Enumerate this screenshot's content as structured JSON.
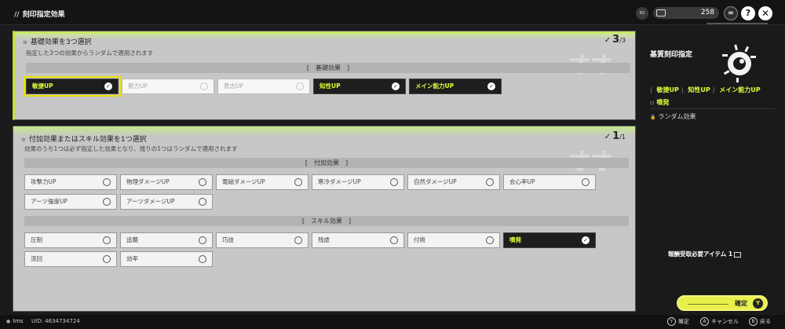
{
  "header": {
    "title": "刻印指定効果",
    "rs_label": "RS",
    "currency_value": "258",
    "link_icon": "link-icon",
    "help_icon": "help-icon",
    "close_icon": "close-icon"
  },
  "basic": {
    "title": "基礎効果を3つ選択",
    "subtitle": "指定した3つの効果からランダムで適用されます",
    "count": "3",
    "total": "/3",
    "section_label": "[　基礎効果　]",
    "options": [
      {
        "label": "敏捷UP",
        "state": "selected"
      },
      {
        "label": "筋力UP",
        "state": "disabled"
      },
      {
        "label": "意志UP",
        "state": "disabled"
      },
      {
        "label": "知性UP",
        "state": "selected"
      },
      {
        "label": "メイン能力UP",
        "state": "selected"
      }
    ]
  },
  "extra": {
    "title": "付加効果またはスキル効果を1つ選択",
    "subtitle": "効果のうち1つは必ず指定した効果となり、残りの1つはランダムで適用されます",
    "count": "1",
    "total": "/1",
    "extra_section_label": "[　付加効果　]",
    "extra_options": [
      {
        "label": "攻撃力UP"
      },
      {
        "label": "物理ダメージUP"
      },
      {
        "label": "電磁ダメージUP"
      },
      {
        "label": "寒冷ダメージUP"
      },
      {
        "label": "自然ダメージUP"
      },
      {
        "label": "会心率UP"
      },
      {
        "label": "アーツ強度UP"
      },
      {
        "label": "アーツダメージUP"
      }
    ],
    "skill_section_label": "[　スキル効果　]",
    "skill_options": [
      {
        "label": "圧制"
      },
      {
        "label": "追襲"
      },
      {
        "label": "巧技"
      },
      {
        "label": "残虐"
      },
      {
        "label": "付術"
      },
      {
        "label": "噴発",
        "state": "selected"
      },
      {
        "label": "流回"
      },
      {
        "label": "効率"
      }
    ]
  },
  "right_panel": {
    "title": "基質刻印指定",
    "tags": [
      "敏捷UP",
      "知性UP",
      "メイン能力UP"
    ],
    "separator": "|",
    "tag2": "噴発",
    "random_label": "ランダム効果",
    "reward_label": "報酬受取必要アイテム",
    "reward_count": "1"
  },
  "confirm": {
    "label": "確定",
    "button": "Y"
  },
  "footer": {
    "user": "tms",
    "uid": "UID: 4634734724",
    "hints": [
      {
        "button": "Y",
        "label": "確定"
      },
      {
        "button": "A",
        "label": "キャンセル"
      },
      {
        "button": "B",
        "label": "戻る"
      }
    ]
  },
  "colors": {
    "accent": "#dfff3a",
    "panel_bg": "#c7c7c7",
    "confirm_bg": "#e7f04a"
  }
}
